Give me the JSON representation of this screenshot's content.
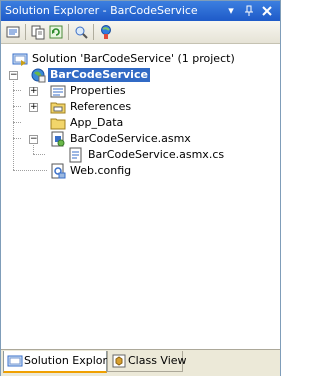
{
  "window": {
    "title": "Solution Explorer - BarCodeService",
    "buttons": [
      "dropdown-icon",
      "pin-icon",
      "close-icon"
    ]
  },
  "toolbar": {
    "buttons": [
      "properties-icon",
      "show-all-files-icon",
      "refresh-icon",
      "view-in-browser-icon",
      "copy-web-site-icon"
    ]
  },
  "tree": {
    "solution": "Solution 'BarCodeService' (1 project)",
    "project": "BarCodeService",
    "items": {
      "properties": "Properties",
      "references": "References",
      "app_data": "App_Data",
      "asmx": "BarCodeService.asmx",
      "asmx_cs": "BarCodeService.asmx.cs",
      "webconfig": "Web.config"
    }
  },
  "tabs": {
    "solution_explorer": "Solution Explorer",
    "class_view": "Class View"
  },
  "colors": {
    "title_bar": "#1e5ac8",
    "selection": "#316ac5",
    "tab_accent": "#f0a000"
  }
}
